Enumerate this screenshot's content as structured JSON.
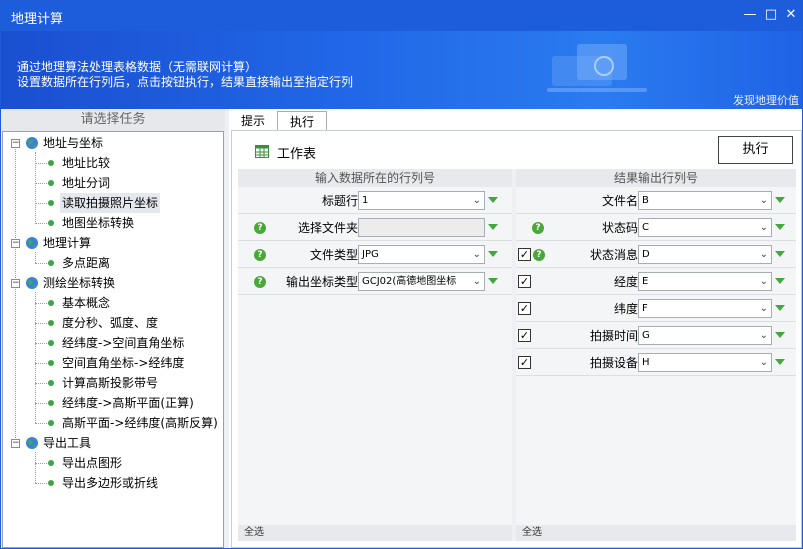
{
  "window": {
    "title": "地理计算"
  },
  "banner": {
    "line1": "通过地理算法处理表格数据（无需联网计算）",
    "line2": "设置数据所在行列后，点击按钮执行，结果直接输出至指定行列",
    "link": "发现地理价值"
  },
  "left": {
    "header": "请选择任务",
    "groups": [
      {
        "label": "地址与坐标",
        "items": [
          "地址比较",
          "地址分词",
          "读取拍摄照片坐标",
          "地图坐标转换"
        ]
      },
      {
        "label": "地理计算",
        "items": [
          "多点距离"
        ]
      },
      {
        "label": "测绘坐标转换",
        "items": [
          "基本概念",
          "度分秒、弧度、度",
          "经纬度->空间直角坐标",
          "空间直角坐标->经纬度",
          "计算高斯投影带号",
          "经纬度->高斯平面(正算)",
          "高斯平面->经纬度(高斯反算)"
        ]
      },
      {
        "label": "导出工具",
        "items": [
          "导出点图形",
          "导出多边形或折线"
        ]
      }
    ],
    "selected_item": "读取拍摄照片坐标"
  },
  "tabs": [
    "提示",
    "执行"
  ],
  "toolbar": {
    "worksheet_label": "工作表",
    "execute_label": "执行"
  },
  "input_panel": {
    "header": "输入数据所在的行列号",
    "rows": [
      {
        "label": "标题行",
        "value": "1",
        "help": false
      },
      {
        "label": "选择文件夹",
        "value": "",
        "help": true
      },
      {
        "label": "文件类型",
        "value": "JPG",
        "help": true
      },
      {
        "label": "输出坐标类型",
        "value": "GCJ02(高德地图坐标",
        "help": true
      }
    ],
    "footer": "全选"
  },
  "output_panel": {
    "header": "结果输出行列号",
    "rows": [
      {
        "label": "文件名",
        "value": "B",
        "help": false,
        "checkbox": false,
        "checked": false
      },
      {
        "label": "状态码",
        "value": "C",
        "help": true,
        "checkbox": false,
        "checked": false
      },
      {
        "label": "状态消息",
        "value": "D",
        "help": true,
        "checkbox": true,
        "checked": true
      },
      {
        "label": "经度",
        "value": "E",
        "help": false,
        "checkbox": true,
        "checked": true
      },
      {
        "label": "纬度",
        "value": "F",
        "help": false,
        "checkbox": true,
        "checked": true
      },
      {
        "label": "拍摄时间",
        "value": "G",
        "help": false,
        "checkbox": true,
        "checked": true
      },
      {
        "label": "拍摄设备",
        "value": "H",
        "help": false,
        "checkbox": true,
        "checked": true
      }
    ],
    "footer": "全选"
  },
  "colors": {
    "titlebar": "#1d5ddc",
    "accent_green": "#43a83c"
  }
}
